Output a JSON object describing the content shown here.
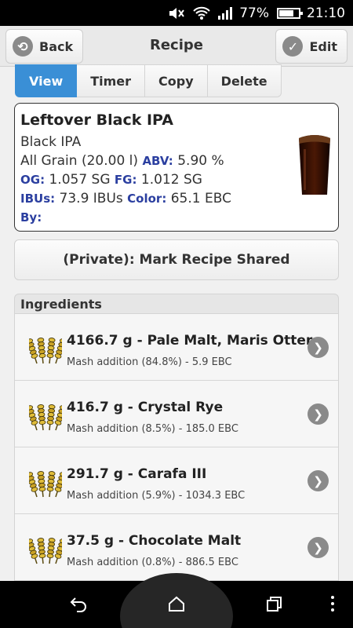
{
  "status_bar": {
    "battery": "77%",
    "time": "21:10",
    "battery_level": 0.77
  },
  "header": {
    "back_label": "Back",
    "title": "Recipe",
    "edit_label": "Edit"
  },
  "tabs": [
    {
      "label": "View",
      "active": true
    },
    {
      "label": "Timer",
      "active": false
    },
    {
      "label": "Copy",
      "active": false
    },
    {
      "label": "Delete",
      "active": false
    }
  ],
  "recipe": {
    "name": "Leftover Black IPA",
    "style": "Black IPA",
    "type": "All Grain (20.00 l)",
    "abv_label": "ABV:",
    "abv": "5.90 %",
    "og_label": "OG:",
    "og": "1.057 SG",
    "fg_label": "FG:",
    "fg": "1.012 SG",
    "ibus_label": "IBUs:",
    "ibus": "73.9 IBUs",
    "color_label": "Color:",
    "color": "65.1 EBC",
    "by_label": "By:"
  },
  "share_button": "(Private): Mark Recipe Shared",
  "ingredients": {
    "header": "Ingredients",
    "items": [
      {
        "title": "4166.7 g - Pale Malt, Maris Otter",
        "detail": "Mash addition (84.8%) - 5.9 EBC"
      },
      {
        "title": "416.7 g - Crystal Rye",
        "detail": "Mash addition (8.5%) - 185.0 EBC"
      },
      {
        "title": "291.7 g - Carafa III",
        "detail": "Mash addition (5.9%) - 1034.3 EBC"
      },
      {
        "title": "37.5 g - Chocolate Malt",
        "detail": "Mash addition (0.8%) - 886.5 EBC"
      }
    ]
  },
  "colors": {
    "accent": "#3a8fd6",
    "label_blue": "#2b3fa0"
  }
}
